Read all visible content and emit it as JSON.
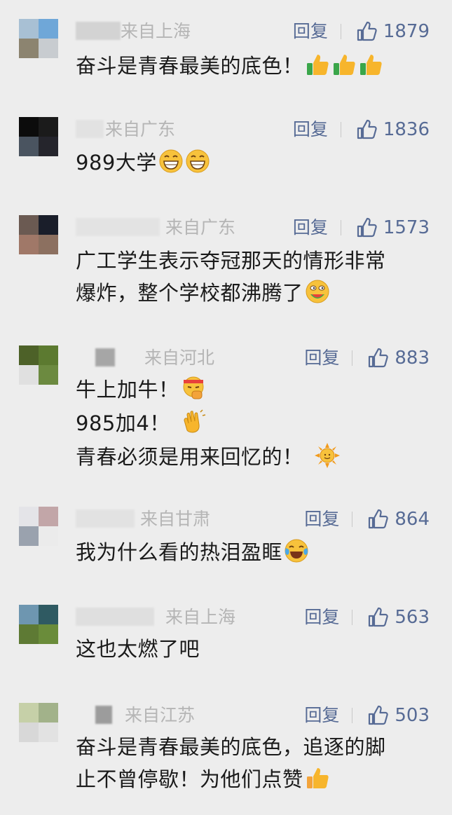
{
  "colors": {
    "background": "#ededed",
    "link": "#576b95",
    "location_gray": "#b5b5b5",
    "text": "#1a1a1a"
  },
  "comments": [
    {
      "location": "来自上海",
      "reply_label": "回复",
      "likes": "1879",
      "lines": [
        "奋斗是青春最美的底色！"
      ],
      "emojis": [
        "thumbs-up-emoji",
        "thumbs-up-emoji",
        "thumbs-up-emoji"
      ],
      "avatar_colors": [
        "#a8c0d4",
        "#6fa7d8",
        "#8c8470",
        "#c8ccd0"
      ]
    },
    {
      "location": "来自广东",
      "reply_label": "回复",
      "likes": "1836",
      "lines": [
        "989大学"
      ],
      "emojis": [
        "grin-emoji",
        "grin-emoji"
      ],
      "avatar_colors": [
        "#0c0c0c",
        "#1b1b1b",
        "#4a5460",
        "#25252c"
      ]
    },
    {
      "location": "来自广东",
      "reply_label": "回复",
      "likes": "1573",
      "lines": [
        "广工学生表示夺冠那天的情形非常",
        "爆炸，整个学校都沸腾了"
      ],
      "emojis": [
        "watermelon-eating-emoji"
      ],
      "avatar_colors": [
        "#6b5a52",
        "#1a1e2a",
        "#a07868",
        "#8c7060"
      ]
    },
    {
      "location": "来自河北",
      "reply_label": "回复",
      "likes": "883",
      "lines": [
        "牛上加牛！",
        "985加4！",
        "青春必须是用来回忆的！"
      ],
      "emojis": [
        "strong-fist-emoji",
        "clap-emoji",
        "sun-emoji"
      ],
      "avatar_colors": [
        "#4d6128",
        "#5c7a30",
        "#e0e0e0",
        "#6c8a40"
      ]
    },
    {
      "location": "来自甘肃",
      "reply_label": "回复",
      "likes": "864",
      "lines": [
        "我为什么看的热泪盈眶"
      ],
      "emojis": [
        "tears-of-joy-emoji"
      ],
      "avatar_colors": [
        "#e4e4e8",
        "#c2a6a8",
        "#9aa2ae",
        "#ebebeb"
      ]
    },
    {
      "location": "来自上海",
      "reply_label": "回复",
      "likes": "563",
      "lines": [
        "这也太燃了吧"
      ],
      "emojis": [],
      "avatar_colors": [
        "#6e96b0",
        "#2f5a62",
        "#5e7a34",
        "#6a8c3a"
      ]
    },
    {
      "location": "来自江苏",
      "reply_label": "回复",
      "likes": "503",
      "lines": [
        "奋斗是青春最美的底色，追逐的脚",
        "止不曾停歇！为他们点赞"
      ],
      "emojis": [
        "thumbs-up-emoji"
      ],
      "avatar_colors": [
        "#c6d0a8",
        "#a2b28a",
        "#d8d8d8",
        "#e2e2e2"
      ]
    }
  ]
}
